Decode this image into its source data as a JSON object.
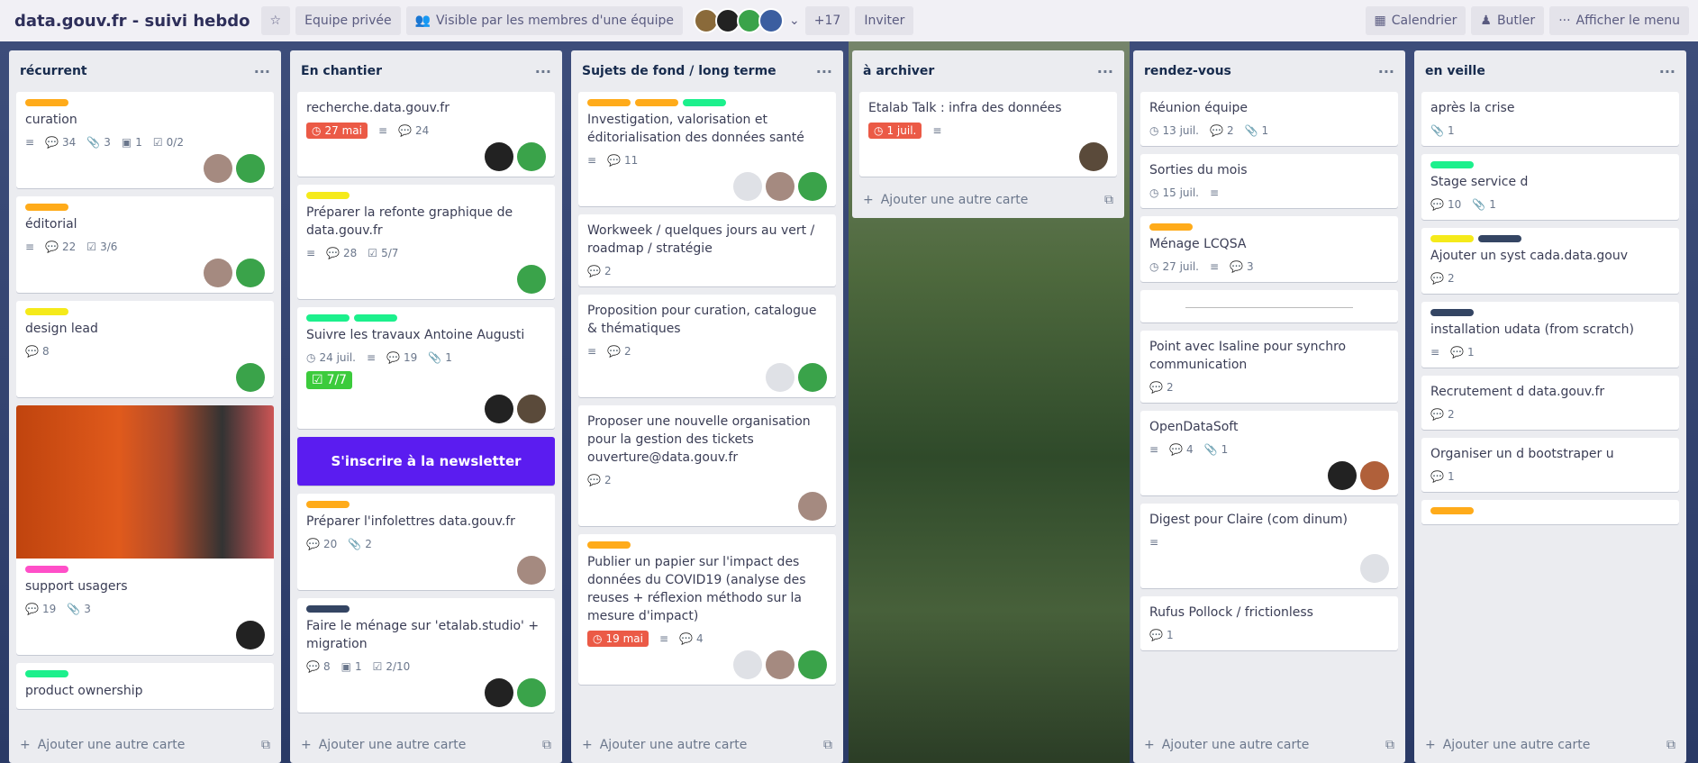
{
  "board": {
    "title": "data.gouv.fr - suivi hebdo",
    "team": "Equipe privée",
    "visibility": "Visible par les membres d'une équipe",
    "extra_members": "+17",
    "invite": "Inviter",
    "calendar": "Calendrier",
    "butler": "Butler",
    "show_menu": "Afficher le menu"
  },
  "members_avatars": [
    "#8a6a3a",
    "#222222",
    "#3aa34a",
    "#3b5ea0"
  ],
  "add_card": "Ajouter une autre carte",
  "columns": [
    {
      "title": "récurrent",
      "cards": [
        {
          "labels": [
            "#ffab1a"
          ],
          "title": "curation",
          "badges": [
            {
              "icon": "description-icon",
              "t": ""
            },
            {
              "icon": "comment-icon",
              "t": "34"
            },
            {
              "icon": "attachment-icon",
              "t": "3"
            },
            {
              "icon": "cover-icon",
              "t": "1"
            },
            {
              "icon": "checklist-icon",
              "t": "0/2"
            }
          ],
          "members": [
            "#a58a80",
            "#3aa34a"
          ]
        },
        {
          "labels": [
            "#ffab1a"
          ],
          "title": "éditorial",
          "badges": [
            {
              "icon": "description-icon",
              "t": ""
            },
            {
              "icon": "comment-icon",
              "t": "22"
            },
            {
              "icon": "checklist-icon",
              "t": "3/6"
            }
          ],
          "members": [
            "#a58a80",
            "#3aa34a"
          ]
        },
        {
          "labels": [
            "#f5ea1a"
          ],
          "title": "design lead",
          "badges": [
            {
              "icon": "comment-icon",
              "t": "8"
            }
          ],
          "members": [
            "#3aa34a"
          ]
        },
        {
          "cover": true,
          "labels": [
            "#ff4fc8"
          ],
          "title": "support usagers",
          "badges": [
            {
              "icon": "comment-icon",
              "t": "19"
            },
            {
              "icon": "attachment-icon",
              "t": "3"
            }
          ],
          "members": [
            "#222222"
          ]
        },
        {
          "labels": [
            "#1cf08c"
          ],
          "title": "product ownership",
          "badges": []
        }
      ]
    },
    {
      "title": "En chantier",
      "cards": [
        {
          "title": "recherche.data.gouv.fr",
          "due": {
            "t": "27 mai",
            "c": "#eb5a46"
          },
          "badges": [
            {
              "icon": "description-icon",
              "t": ""
            },
            {
              "icon": "comment-icon",
              "t": "24"
            }
          ],
          "members": [
            "#222222",
            "#3aa34a"
          ]
        },
        {
          "labels": [
            "#f5ea1a"
          ],
          "title": "Préparer la refonte graphique de data.gouv.fr",
          "badges": [
            {
              "icon": "description-icon",
              "t": ""
            },
            {
              "icon": "comment-icon",
              "t": "28"
            },
            {
              "icon": "checklist-icon",
              "t": "5/7"
            }
          ],
          "members": [
            "#3aa34a"
          ]
        },
        {
          "labels": [
            "#1cf08c",
            "#1cf08c"
          ],
          "title": "Suivre les travaux Antoine Augusti",
          "badges": [
            {
              "icon": "clock-icon",
              "t": "24 juil."
            },
            {
              "icon": "description-icon",
              "t": ""
            },
            {
              "icon": "comment-icon",
              "t": "19"
            },
            {
              "icon": "attachment-icon",
              "t": "1"
            }
          ],
          "done": {
            "t": "7/7",
            "c": "#3ccb3c"
          },
          "members": [
            "#222222",
            "#5a4a3a"
          ]
        },
        {
          "promo": "S'inscrire à la newsletter",
          "labels": [
            "#ffab1a"
          ],
          "title": "Préparer l'infolettres data.gouv.fr",
          "badges": [
            {
              "icon": "comment-icon",
              "t": "20"
            },
            {
              "icon": "attachment-icon",
              "t": "2"
            }
          ],
          "members": [
            "#a58a80"
          ]
        },
        {
          "labels": [
            "#344563"
          ],
          "title": "Faire le ménage sur 'etalab.studio' + migration",
          "badges": [
            {
              "icon": "comment-icon",
              "t": "8"
            },
            {
              "icon": "cover-icon",
              "t": "1"
            },
            {
              "icon": "checklist-icon",
              "t": "2/10"
            }
          ],
          "members": [
            "#222222",
            "#3aa34a"
          ]
        }
      ]
    },
    {
      "title": "Sujets de fond / long terme",
      "cards": [
        {
          "labels": [
            "#ffab1a",
            "#ffab1a",
            "#1cf08c"
          ],
          "title": "Investigation, valorisation et éditorialisation des données santé",
          "badges": [
            {
              "icon": "description-icon",
              "t": ""
            },
            {
              "icon": "comment-icon",
              "t": "11"
            }
          ],
          "members": [
            "#dfe1e6",
            "#a58a80",
            "#3aa34a"
          ]
        },
        {
          "title": "Workweek / quelques jours au vert / roadmap / stratégie",
          "badges": [
            {
              "icon": "comment-icon",
              "t": "2"
            }
          ]
        },
        {
          "title": "Proposition pour curation, catalogue & thématiques",
          "badges": [
            {
              "icon": "description-icon",
              "t": ""
            },
            {
              "icon": "comment-icon",
              "t": "2"
            }
          ],
          "members": [
            "#dfe1e6",
            "#3aa34a"
          ]
        },
        {
          "title": "Proposer une nouvelle organisation pour la gestion des tickets ouverture@data.gouv.fr",
          "badges": [
            {
              "icon": "comment-icon",
              "t": "2"
            }
          ],
          "members": [
            "#a58a80"
          ]
        },
        {
          "labels": [
            "#ffab1a"
          ],
          "title": "Publier un papier sur l'impact des données du COVID19 (analyse des reuses + réflexion méthodo sur la mesure d'impact)",
          "due": {
            "t": "19 mai",
            "c": "#eb5a46"
          },
          "badges": [
            {
              "icon": "description-icon",
              "t": ""
            },
            {
              "icon": "comment-icon",
              "t": "4"
            }
          ],
          "members": [
            "#dfe1e6",
            "#a58a80",
            "#3aa34a"
          ]
        }
      ]
    },
    {
      "title": "à archiver",
      "short": true,
      "cards": [
        {
          "title": "Etalab Talk : infra des données",
          "due": {
            "t": "1 juil.",
            "c": "#eb5a46"
          },
          "badges": [
            {
              "icon": "description-icon",
              "t": ""
            }
          ],
          "members": [
            "#5a4a3a"
          ]
        }
      ]
    },
    {
      "title": "rendez-vous",
      "cards": [
        {
          "title": "Réunion équipe",
          "badges": [
            {
              "icon": "clock-icon",
              "t": "13 juil."
            },
            {
              "icon": "comment-icon",
              "t": "2"
            },
            {
              "icon": "attachment-icon",
              "t": "1"
            }
          ]
        },
        {
          "title": "Sorties du mois",
          "badges": [
            {
              "icon": "clock-icon",
              "t": "15 juil."
            },
            {
              "icon": "description-icon",
              "t": ""
            }
          ]
        },
        {
          "labels": [
            "#ffab1a"
          ],
          "title": "Ménage LCQSA",
          "badges": [
            {
              "icon": "clock-icon",
              "t": "27 juil."
            },
            {
              "icon": "description-icon",
              "t": ""
            },
            {
              "icon": "comment-icon",
              "t": "3"
            }
          ]
        },
        {
          "separator": true
        },
        {
          "title": "Point avec Isaline pour synchro communication",
          "badges": [
            {
              "icon": "comment-icon",
              "t": "2"
            }
          ]
        },
        {
          "title": "OpenDataSoft",
          "badges": [
            {
              "icon": "description-icon",
              "t": ""
            },
            {
              "icon": "comment-icon",
              "t": "4"
            },
            {
              "icon": "attachment-icon",
              "t": "1"
            }
          ],
          "members": [
            "#222222",
            "#b0603a"
          ]
        },
        {
          "title": "Digest pour Claire (com dinum)",
          "badges": [
            {
              "icon": "description-icon",
              "t": ""
            }
          ],
          "members": [
            "#dfe1e6"
          ]
        },
        {
          "title": "Rufus Pollock / frictionless",
          "badges": [
            {
              "icon": "comment-icon",
              "t": "1"
            }
          ]
        }
      ]
    },
    {
      "title": "en veille",
      "cards": [
        {
          "title": "après la crise",
          "badges": [
            {
              "icon": "attachment-icon",
              "t": "1"
            }
          ]
        },
        {
          "labels": [
            "#1cf08c"
          ],
          "title": "Stage service d",
          "badges": [
            {
              "icon": "comment-icon",
              "t": "10"
            },
            {
              "icon": "attachment-icon",
              "t": "1"
            }
          ]
        },
        {
          "labels": [
            "#f5ea1a",
            "#344563"
          ],
          "title": "Ajouter un syst cada.data.gouv",
          "badges": [
            {
              "icon": "comment-icon",
              "t": "2"
            }
          ]
        },
        {
          "labels": [
            "#344563"
          ],
          "title": "installation udata (from scratch)",
          "badges": [
            {
              "icon": "description-icon",
              "t": ""
            },
            {
              "icon": "comment-icon",
              "t": "1"
            }
          ]
        },
        {
          "title": "Recrutement d data.gouv.fr",
          "badges": [
            {
              "icon": "comment-icon",
              "t": "2"
            }
          ]
        },
        {
          "title": "Organiser un d bootstraper u",
          "badges": [
            {
              "icon": "comment-icon",
              "t": "1"
            }
          ]
        },
        {
          "labels": [
            "#ffab1a"
          ],
          "title": "",
          "badges": []
        }
      ]
    }
  ]
}
